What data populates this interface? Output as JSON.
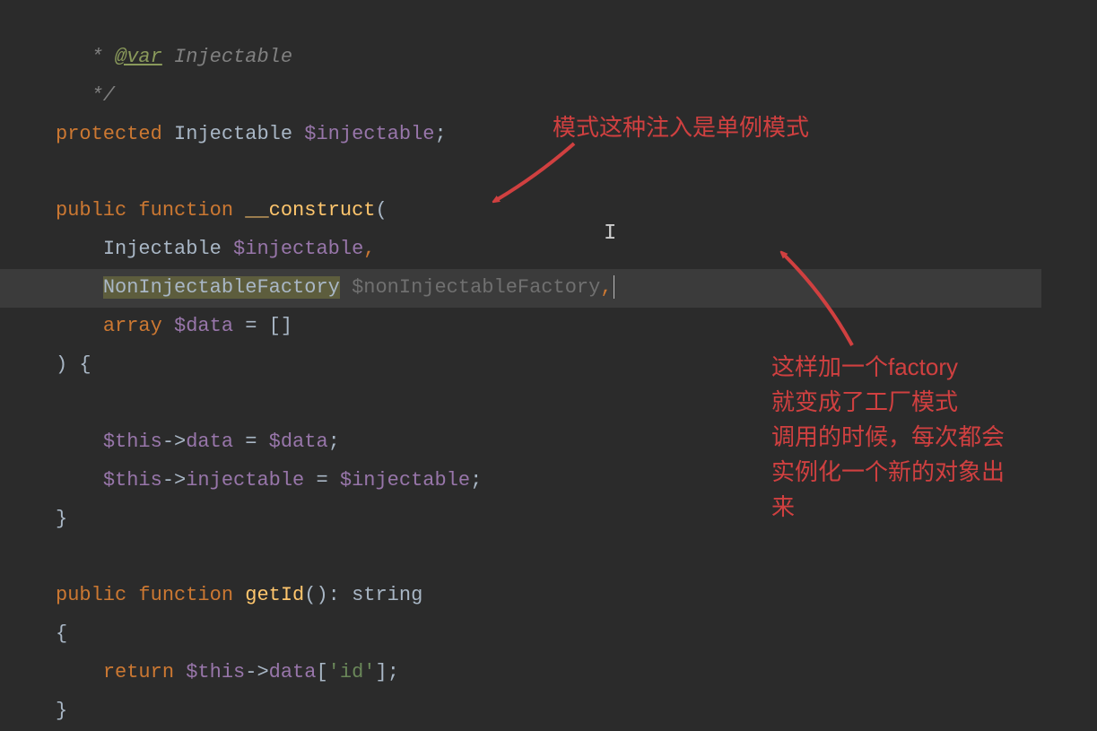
{
  "code": {
    "line1_star": " * ",
    "line1_tag": "@var",
    "line1_type": " Injectable",
    "line2": " */",
    "line3_kw1": "protected",
    "line3_type": " Injectable ",
    "line3_var": "$injectable",
    "line3_semi": ";",
    "line5_kw1": "public",
    "line5_kw2": " function ",
    "line5_fn": "__construct",
    "line5_paren": "(",
    "line6_type": "Injectable ",
    "line6_var": "$injectable",
    "line6_comma": ",",
    "line7_type": "NonInjectableFactory",
    "line7_space": " ",
    "line7_var": "$nonInjectableFactory",
    "line7_comma": ",",
    "line8_kw": "array",
    "line8_sp": " ",
    "line8_var": "$data",
    "line8_rest": " = []",
    "line9": ") {",
    "line11_this": "$this",
    "line11_arrow": "->",
    "line11_prop": "data",
    "line11_eq": " = ",
    "line11_var": "$data",
    "line11_semi": ";",
    "line12_this": "$this",
    "line12_arrow": "->",
    "line12_prop": "injectable",
    "line12_eq": " = ",
    "line12_var": "$injectable",
    "line12_semi": ";",
    "line13": "}",
    "line15_kw1": "public",
    "line15_kw2": " function ",
    "line15_fn": "getId",
    "line15_rest1": "()",
    "line15_colon": ": ",
    "line15_ret": "string",
    "line16": "{",
    "line17_kw": "return",
    "line17_sp": " ",
    "line17_this": "$this",
    "line17_arrow": "->",
    "line17_prop": "data",
    "line17_bracket": "[",
    "line17_str": "'id'",
    "line17_bracketc": "]",
    "line17_semi": ";",
    "line18": "}"
  },
  "annotations": {
    "anno1": "模式这种注入是单例模式",
    "anno2_l1": "这样加一个factory",
    "anno2_l2": "就变成了工厂模式",
    "anno2_l3": "调用的时候，每次都会",
    "anno2_l4": "实例化一个新的对象出",
    "anno2_l5": "来"
  }
}
